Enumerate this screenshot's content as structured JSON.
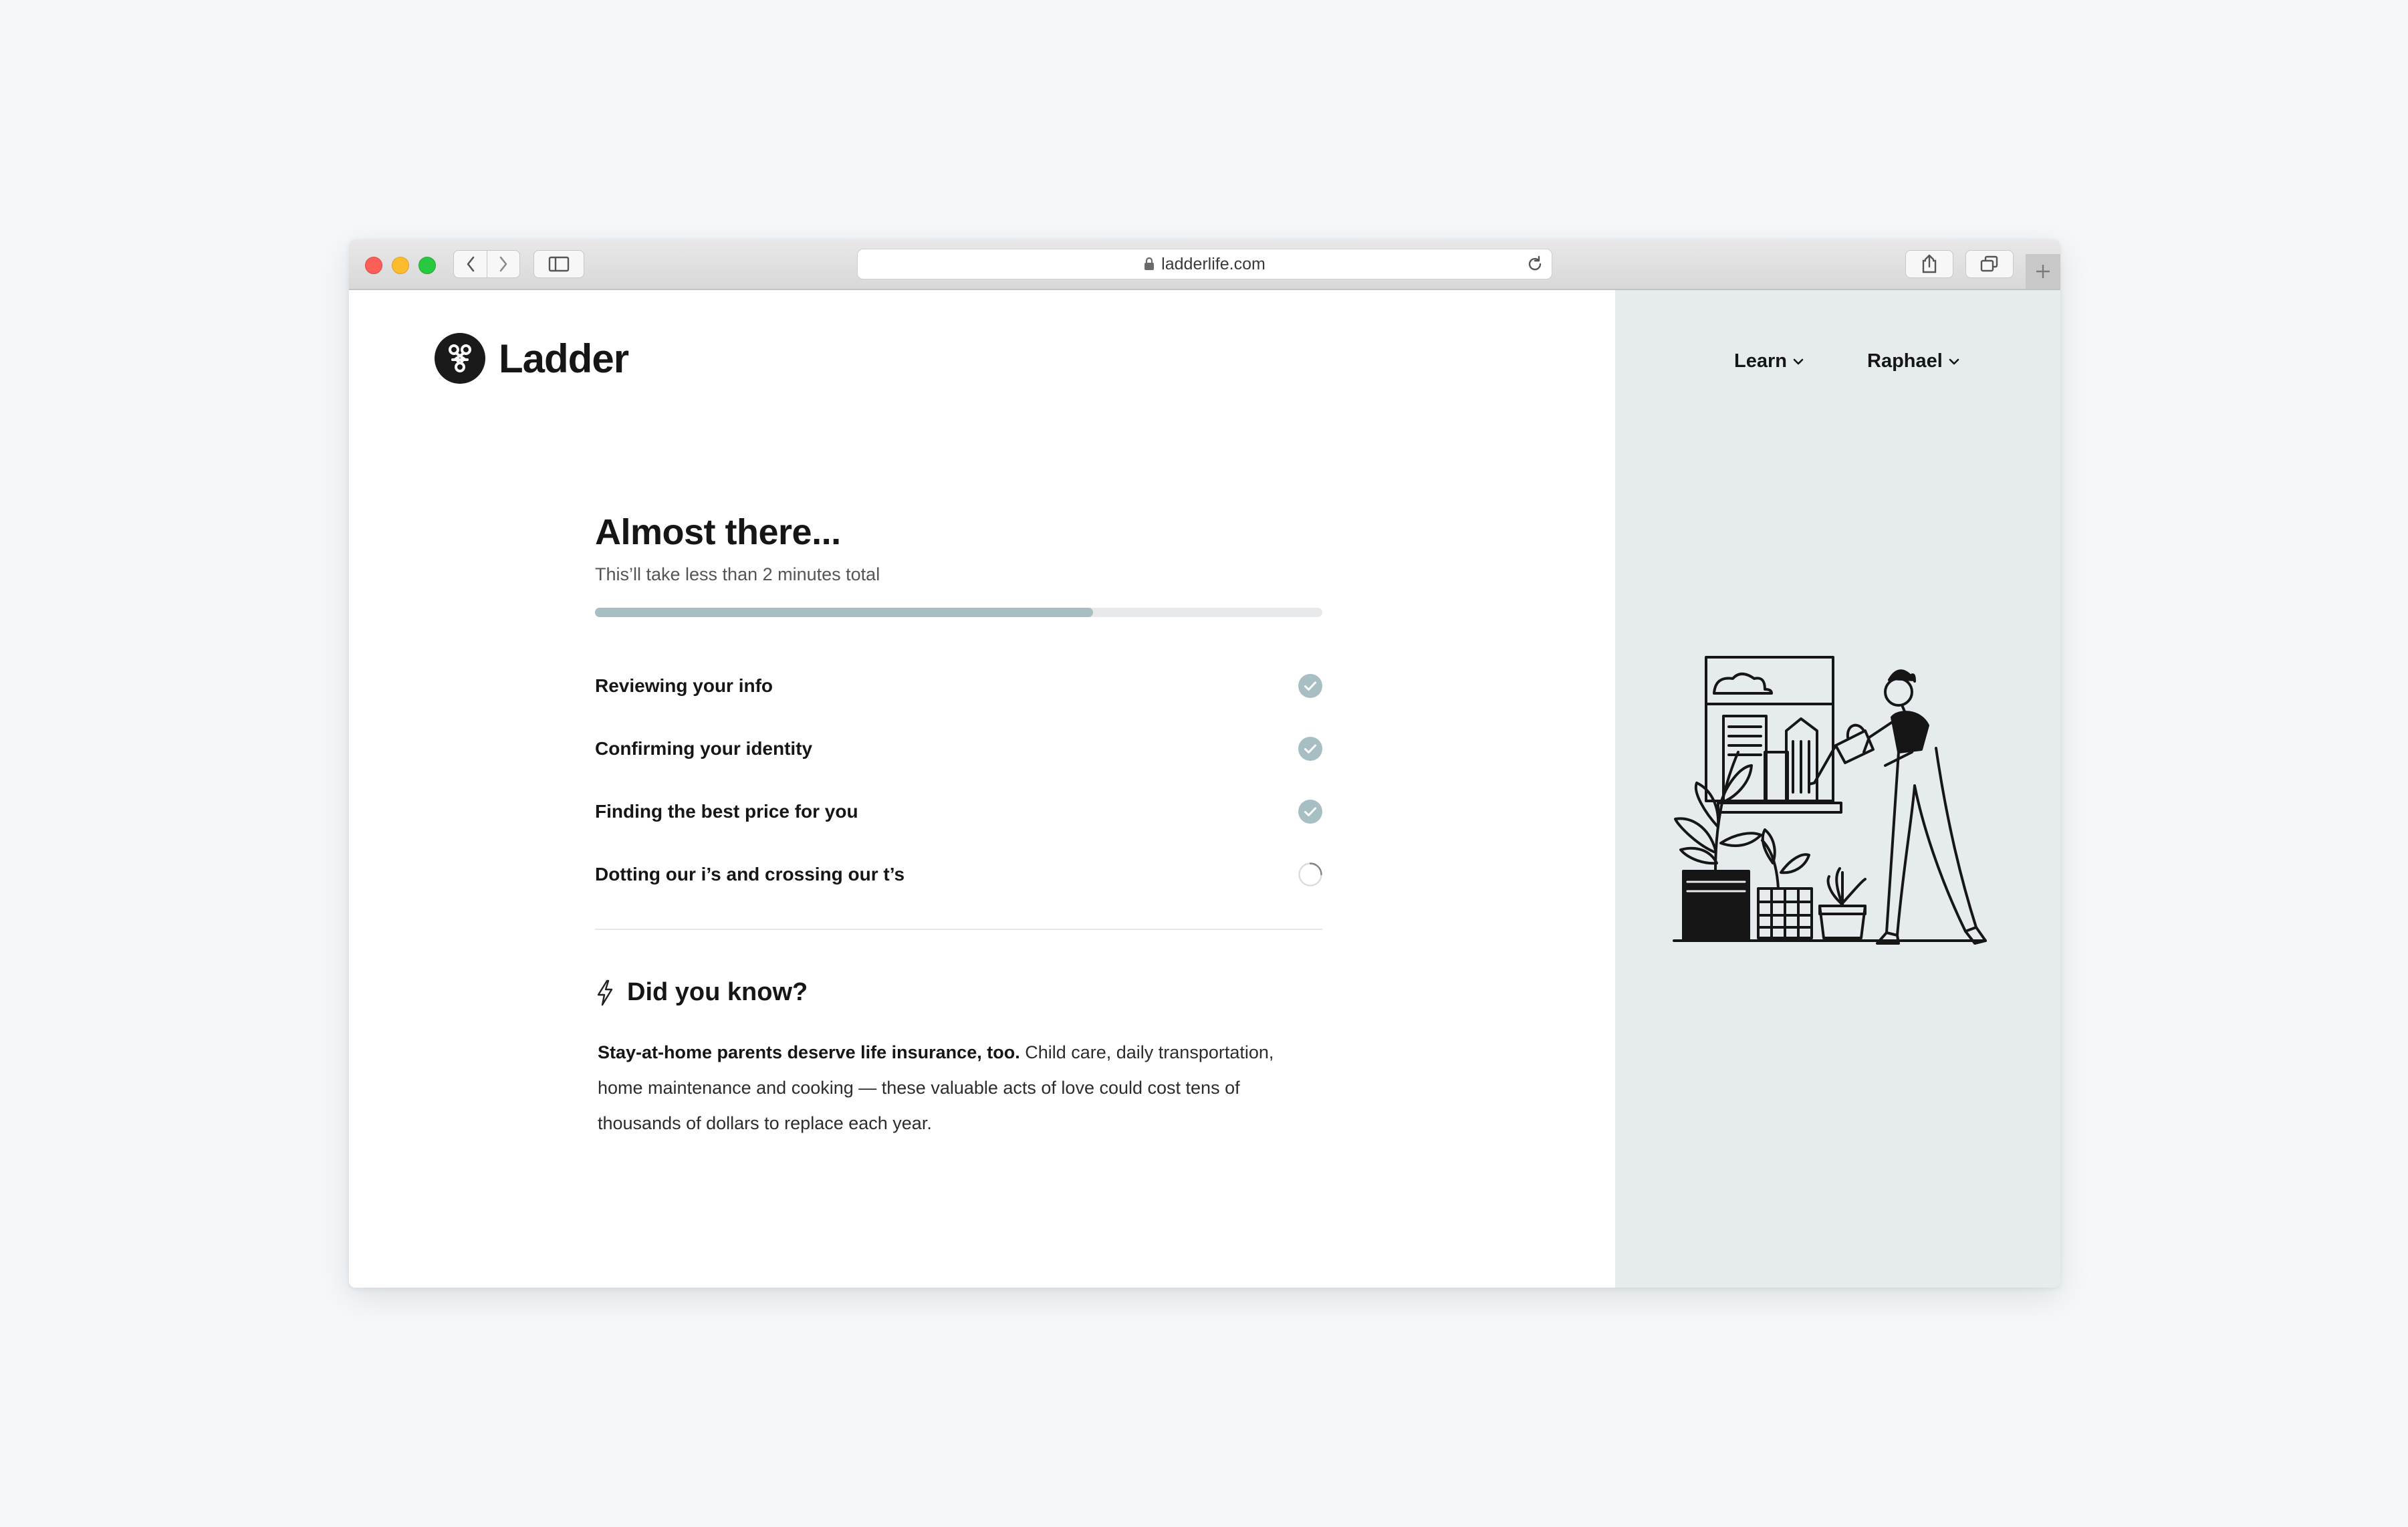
{
  "browser": {
    "url": "ladderlife.com"
  },
  "brand": {
    "name": "Ladder"
  },
  "nav": {
    "learn": "Learn",
    "user": "Raphael"
  },
  "main": {
    "heading": "Almost there...",
    "subheading": "This’ll take less than 2 minutes total",
    "progress": 0.685,
    "steps": [
      {
        "label": "Reviewing your info",
        "status": "complete"
      },
      {
        "label": "Confirming your identity",
        "status": "complete"
      },
      {
        "label": "Finding the best price for you",
        "status": "complete"
      },
      {
        "label": "Dotting our i’s and crossing our t’s",
        "status": "pending"
      }
    ]
  },
  "did_you_know": {
    "title": "Did you know?",
    "lead": "Stay-at-home parents deserve life insurance, too.",
    "body": " Child care, daily transportation, home maintenance and cooking — these valuable acts of love could cost tens of thousands of dollars to replace each year."
  },
  "colors": {
    "accent": "#a7bfc2",
    "side_panel": "#e6ecee",
    "text": "#161616"
  }
}
